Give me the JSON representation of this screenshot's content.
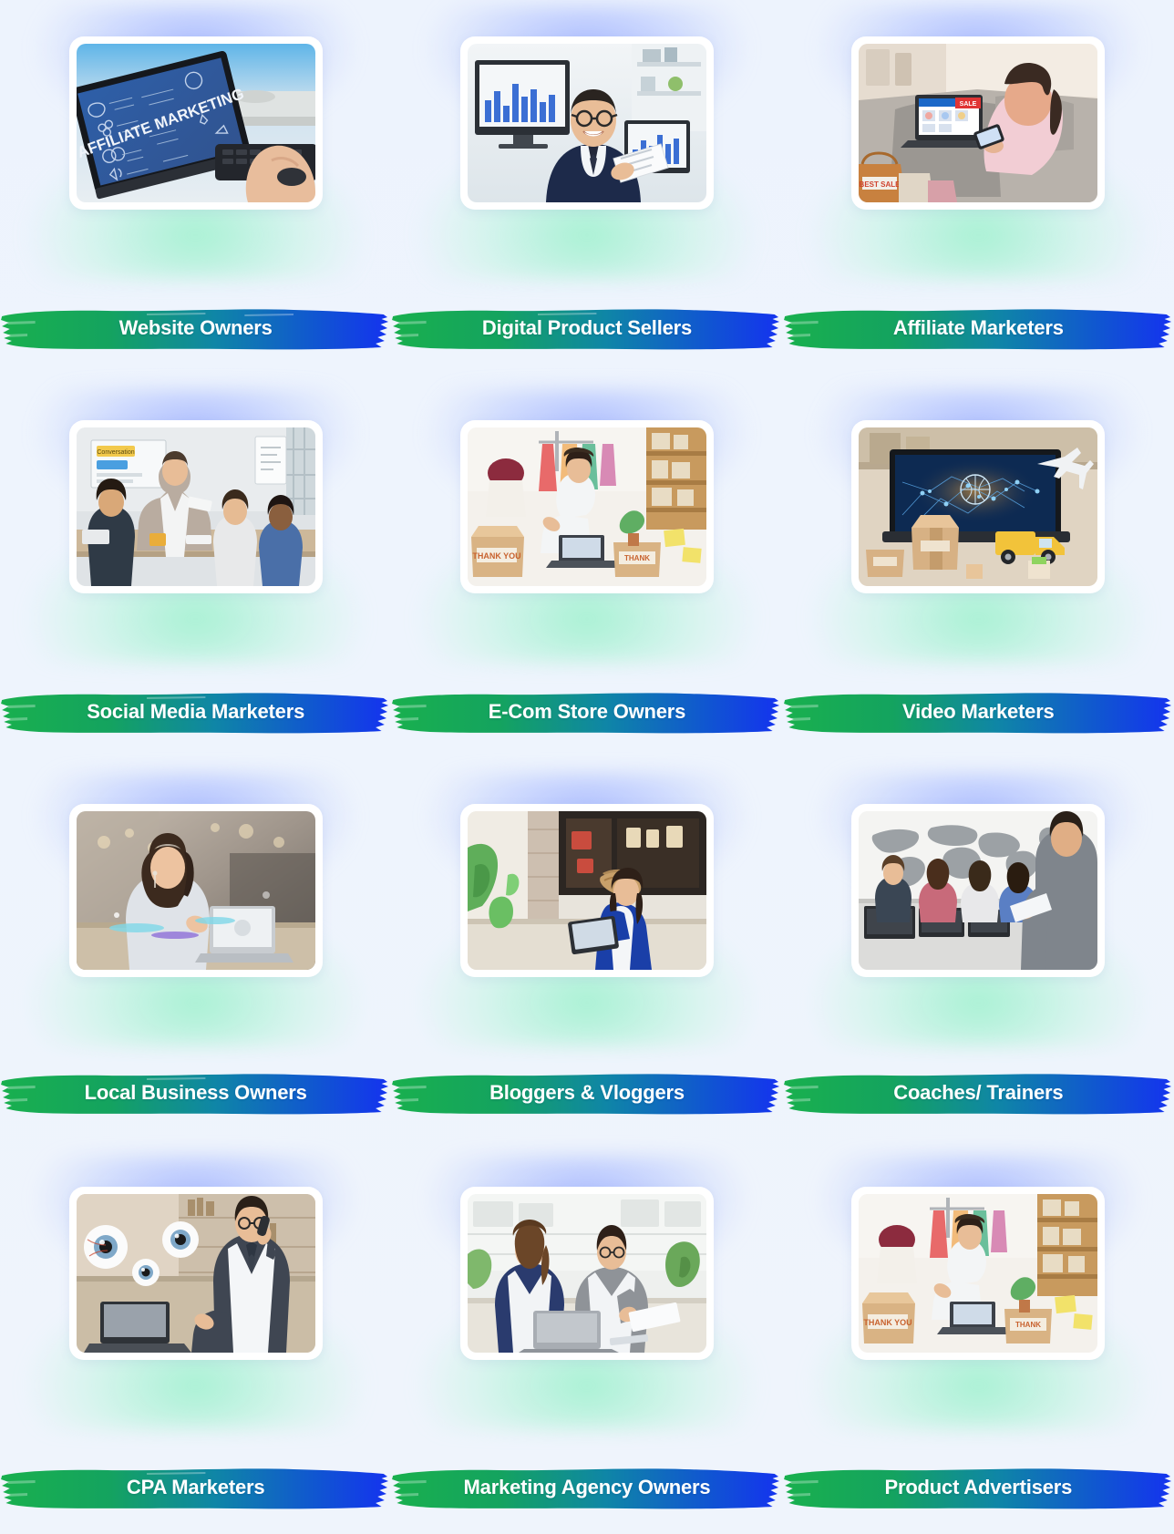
{
  "section": {
    "layout": "grid-3x4",
    "card_count": 12,
    "background_color": "#eef4fd",
    "banner_gradient_start": "#16a94c",
    "banner_gradient_mid": "#1189a8",
    "banner_gradient_end": "#1340e8",
    "label_color": "#ffffff",
    "glow_top_color": "#97aaff",
    "glow_bottom_color": "#8cf0c3"
  },
  "cards": [
    {
      "label": "Website Owners",
      "image_alt": "Laptop screen displaying an Affiliate Marketing infographic with hands typing on keyboard",
      "image_name": "affiliate-marketing-laptop-photo"
    },
    {
      "label": "Digital Product Sellers",
      "image_alt": "Smiling businessman in suit holding documents in front of monitors showing bar charts",
      "image_name": "businessman-charts-photo"
    },
    {
      "label": "Affiliate Marketers",
      "image_alt": "Woman on a couch shopping online with a laptop showing a SALE banner and shopping bags nearby",
      "image_name": "online-shopping-couch-photo"
    },
    {
      "label": "Social Media Marketers",
      "image_alt": "Man presenting to a seated team in a bright modern meeting room with a whiteboard",
      "image_name": "team-presentation-photo"
    },
    {
      "label": "E-Com Store Owners",
      "image_alt": "Woman packing orders in a clothing boutique with THANK YOU boxes and a laptop",
      "image_name": "ecommerce-packing-photo"
    },
    {
      "label": "Video Marketers",
      "image_alt": "Laptop with a global logistics graphic, cardboard boxes, toy delivery truck and airplane",
      "image_name": "logistics-laptop-photo"
    },
    {
      "label": "Local Business Owners",
      "image_alt": "Woman wearing earphones working on a laptop in a modern cafe interior",
      "image_name": "woman-laptop-cafe-photo"
    },
    {
      "label": "Bloggers & Vloggers",
      "image_alt": "Woman in a blue blazer using a tablet at a cafe counter beside plants and baskets",
      "image_name": "blogger-tablet-cafe-photo"
    },
    {
      "label": "Coaches/ Trainers",
      "image_alt": "Trainer standing in front of a world map addressing a small group at computer desks",
      "image_name": "trainer-world-map-photo"
    },
    {
      "label": "CPA Marketers",
      "image_alt": "Businessman on the phone at a laptop with large floating eyeball graphics around him",
      "image_name": "cpa-eyeballs-photo"
    },
    {
      "label": "Marketing Agency Owners",
      "image_alt": "Two colleagues reviewing paperwork together at a desk with a laptop in a bright office",
      "image_name": "agency-team-desk-photo"
    },
    {
      "label": "Product Advertisers",
      "image_alt": "Woman in a boutique packing products into THANK YOU boxes with a laptop on the table",
      "image_name": "product-packing-photo"
    }
  ]
}
